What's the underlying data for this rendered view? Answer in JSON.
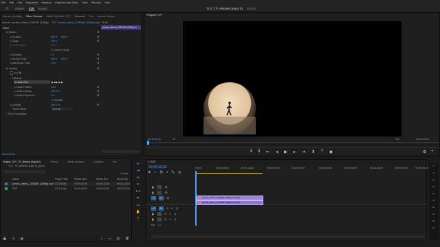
{
  "menu": [
    "File",
    "Edit",
    "Clip",
    "Sequence",
    "Markers",
    "Graphics and Titles",
    "View",
    "Window",
    "Help"
  ],
  "workspaces": [
    "Import",
    "Edit",
    "Export"
  ],
  "active_workspace": "Edit",
  "app_title": "TUT_TP_Retime (Squiz 0)",
  "app_title_state": "Edited",
  "left_tabs": [
    "Source: (no clips)",
    "Effect Controls",
    "Audio Clip Mixer: TUT",
    "Metadata",
    "Text",
    "Lumetri Scopes"
  ],
  "fx": {
    "source_clip": "Source + pexels_videos_2159180 (1080p)",
    "seq_clip": "TUT * pexels_videos_2159180 (1080p).mp4",
    "ruler_label": "00:00",
    "mini_clip": "pexels_videos_2159180 (1080p).m",
    "video_label": "Video",
    "motion": "Motion",
    "position": {
      "label": "Position",
      "v1": "960.0",
      "v2": "540.0"
    },
    "scale": {
      "label": "Scale",
      "v": "100.0"
    },
    "scale_width": {
      "label": "Scale Width",
      "v": "100.0"
    },
    "uniform": "Uniform Scale",
    "rotation": {
      "label": "Rotation",
      "v": "0.0"
    },
    "anchor": {
      "label": "Anchor Point",
      "v1": "960.0",
      "v2": "540.0"
    },
    "antiflicker": {
      "label": "Anti-flicker Filter",
      "v": "0.00"
    },
    "opacity_section": "Opacity",
    "mask": "Mask (1)",
    "mask_path": "Mask Path",
    "mask_feather": {
      "label": "Mask Feather",
      "v": "10.0"
    },
    "mask_opacity": {
      "label": "Mask Opacity",
      "v": "100.0 %"
    },
    "mask_expansion": {
      "label": "Mask Expansion",
      "v": "0.0"
    },
    "inverted": "Inverted",
    "opacity": {
      "label": "Opacity",
      "v": "100.0 %"
    },
    "blend": {
      "label": "Blend Mode",
      "v": "Normal"
    },
    "time_remap": "Time Remapping",
    "timecode": "00:00:00:00"
  },
  "program": {
    "tab": "Program: TUT",
    "timecode_left": "00;00;00;00",
    "fit": "Fit",
    "quality": "Full",
    "timecode_right": "00;00;13;01"
  },
  "project": {
    "tabs": [
      "Project: TUT_TP_Retime (Squiz 0)",
      "Effects",
      "Media Browser",
      "Libraries",
      "Info"
    ],
    "file": "TUT_TP_Retime (Squiz 0).prproj",
    "count": "2 items",
    "columns": [
      "Name",
      "Frame Rate",
      "Media Start",
      "Media End",
      "Media Dur"
    ],
    "rows": [
      {
        "name": "pexels_videos_2159180 (1080p).mp4",
        "fps": "23.976 fps",
        "start": "00;00;00;00",
        "end": "00;00;13;00",
        "dur": "00;00;13;01"
      },
      {
        "name": "TUT",
        "fps": "23.976 fps",
        "start": "00;00;00;00",
        "end": "00;00;13;00",
        "dur": "00;00;13;01"
      }
    ]
  },
  "timeline": {
    "tab": "TUT",
    "timecode": "00;00;00;00",
    "ruler": [
      "00;00",
      "00;00;05;00",
      "00;00;10;00",
      "00;00;15;00",
      "00;00;20;00",
      "00;00;25;00",
      "00;00;30;00",
      "00;00;35;00",
      "00;00;40;00",
      "00;00;45;00"
    ],
    "tracks": [
      {
        "name": "V3",
        "code": "V3"
      },
      {
        "name": "V2",
        "code": "V2"
      },
      {
        "name": "V1",
        "code": "V1",
        "src": "V1"
      },
      {
        "name": "A1",
        "code": "A1",
        "src": "A1"
      },
      {
        "name": "A2",
        "code": "A2"
      },
      {
        "name": "A3",
        "code": "A3"
      }
    ],
    "mix": {
      "label": "Mix",
      "value": "0.0"
    },
    "video_clip": "pexels_videos_2159180 (1080p).mp4 [V]",
    "audio_clip": "pexels_videos_2159180 (1080p).mp4 [A]"
  },
  "meter_labels": [
    "0",
    "-6",
    "-12",
    "-18",
    "-24",
    "-30",
    "-36",
    "-42",
    "-48",
    "-54"
  ],
  "colors": {
    "accent": "#3d8cff",
    "clip": "#9b84d6",
    "bg": "#1b1b1b"
  }
}
